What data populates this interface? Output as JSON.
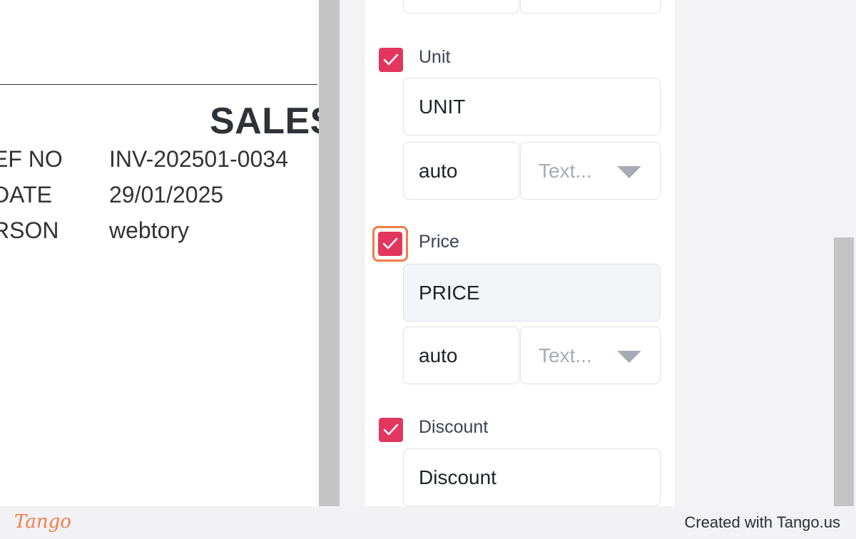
{
  "preview": {
    "doc_title": "SALES",
    "meta": [
      {
        "label": "EF NO",
        "value": "INV-202501-0034"
      },
      {
        "label": "DATE",
        "value": "29/01/2025"
      },
      {
        "label": "RSON",
        "value": "webtory"
      }
    ]
  },
  "fields": {
    "unit": {
      "label": "Unit",
      "checked": true,
      "header_value": "UNIT",
      "width_value": "auto",
      "type_placeholder": "Text..."
    },
    "price": {
      "label": "Price",
      "checked": true,
      "header_value": "PRICE",
      "width_value": "auto",
      "type_placeholder": "Text..."
    },
    "discount": {
      "label": "Discount",
      "checked": true,
      "header_value": "Discount"
    }
  },
  "footer": {
    "logo": "Tango",
    "credit": "Created with Tango.us"
  },
  "colors": {
    "checkbox": "#e3365e",
    "focus_ring": "#f27b48",
    "brand": "#f27b48"
  },
  "icons": {
    "checkmark": "check-icon",
    "dropdown": "caret-down-icon"
  }
}
